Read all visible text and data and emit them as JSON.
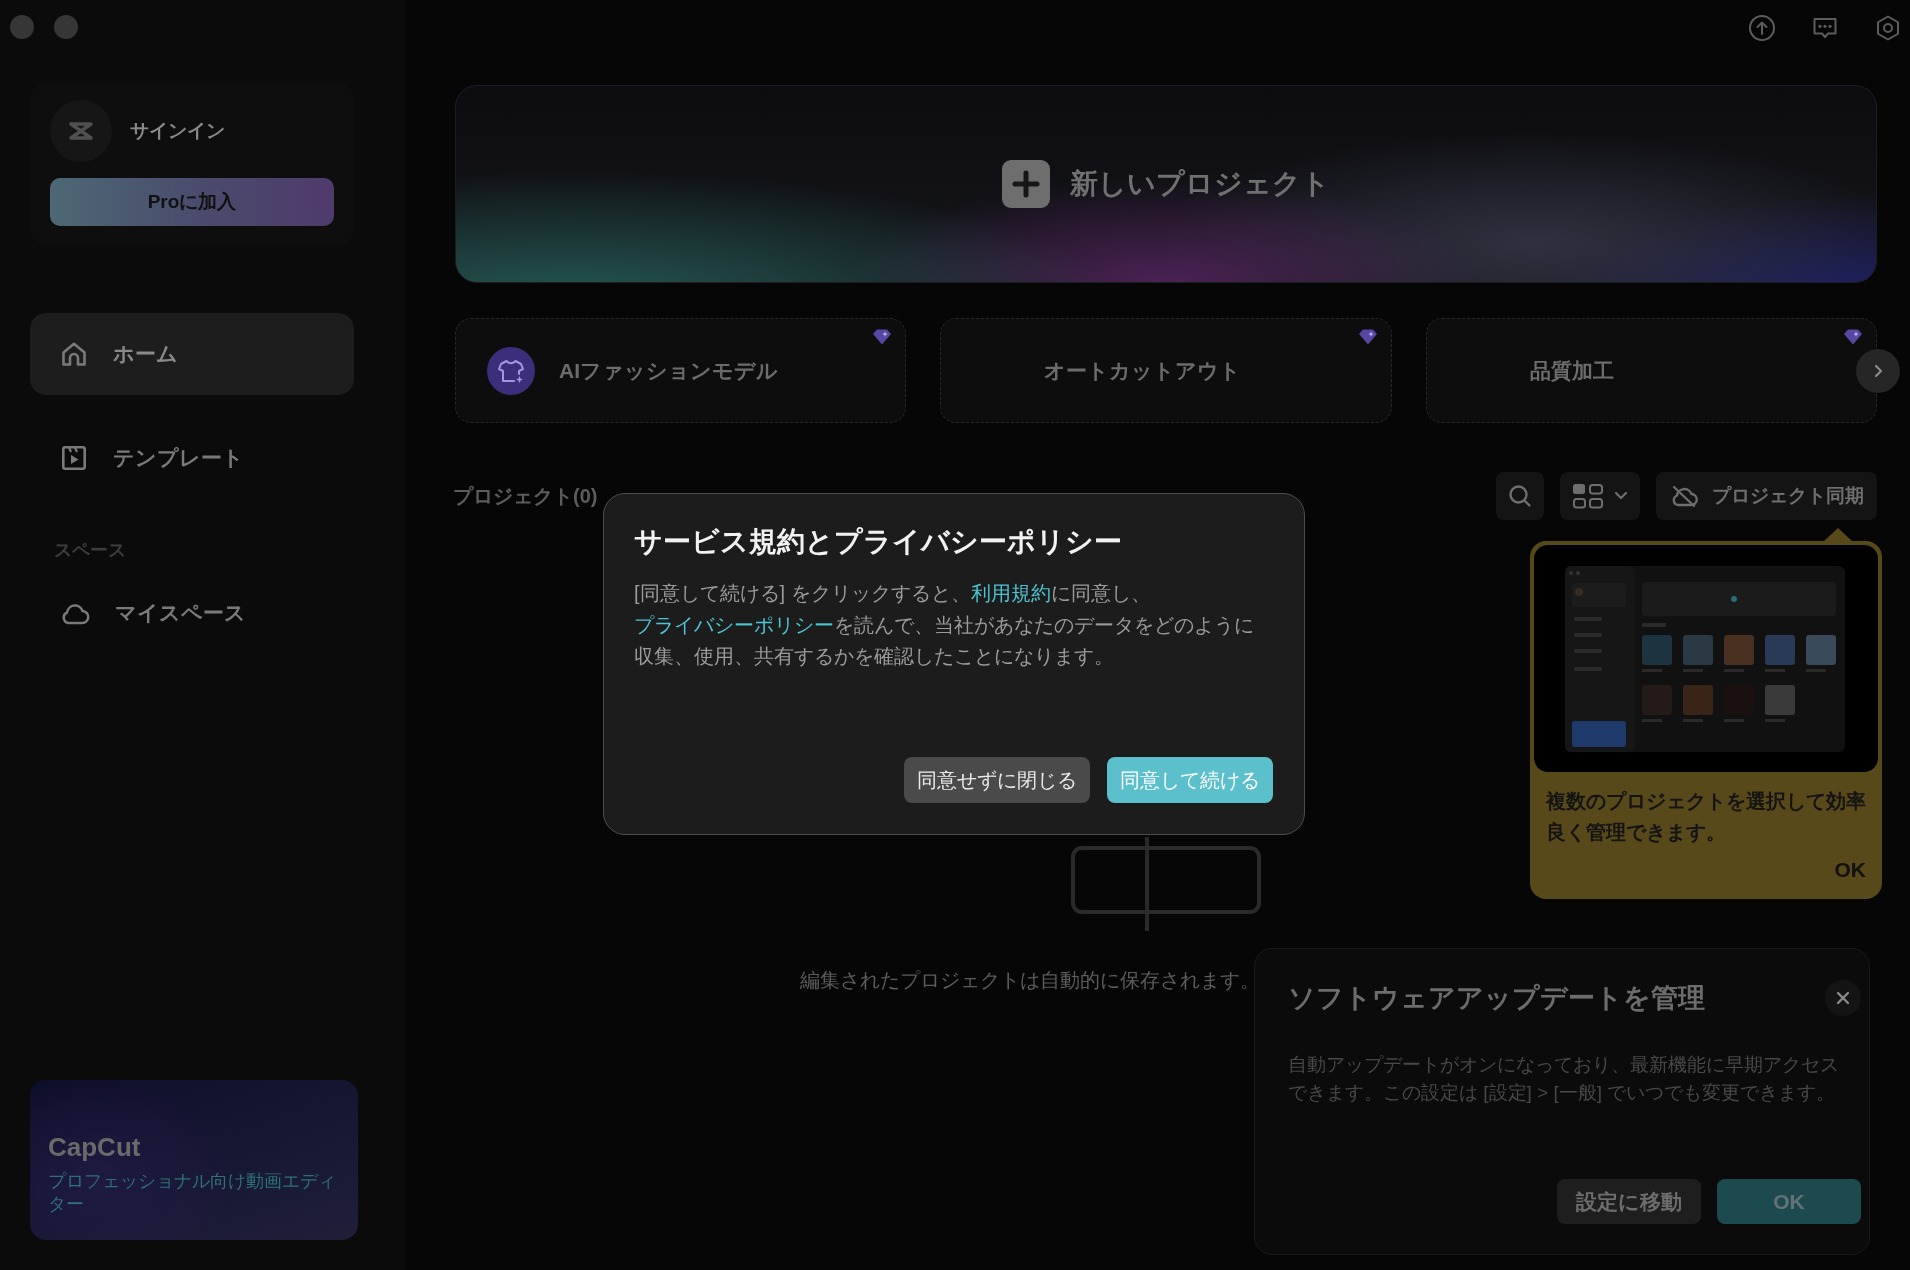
{
  "sidebar": {
    "account": {
      "label": "サインイン",
      "pro_button": "Proに加入"
    },
    "nav": [
      {
        "label": "ホーム",
        "selected": true
      },
      {
        "label": "テンプレート",
        "selected": false
      }
    ],
    "space_section": {
      "title": "スペース",
      "items": [
        {
          "label": "マイスペース",
          "selected": false
        }
      ]
    },
    "promo": {
      "title": "CapCut",
      "subtitle": "プロフェッショナル向け動画エディター"
    }
  },
  "banner": {
    "label": "新しいプロジェクト"
  },
  "features": [
    {
      "label": "AIファッションモデル",
      "premium": true
    },
    {
      "label": "オートカットアウト",
      "premium": true
    },
    {
      "label": "品質加工",
      "premium": true
    }
  ],
  "projects": {
    "title": "プロジェクト(0)",
    "sync_button": "プロジェクト同期",
    "empty_text": "編集されたプロジェクトは自動的に保存されます。"
  },
  "dialog": {
    "title": "サービス規約とプライバシーポリシー",
    "body": [
      {
        "kind": "text",
        "text": "[同意して続ける] をクリックすると、"
      },
      {
        "kind": "link",
        "text": "利用規約"
      },
      {
        "kind": "text",
        "text": "に同意し、"
      },
      {
        "kind": "link",
        "text": "プライバシーポリシー"
      },
      {
        "kind": "text",
        "text": "を読んで、当社があなたのデータをどのように収集、使用、共有するかを確認したことになります。"
      }
    ],
    "buttons": [
      {
        "label": "同意せずに閉じる",
        "kind": "secondary"
      },
      {
        "label": "同意して続ける",
        "kind": "primary"
      }
    ]
  },
  "tooltip": {
    "text": "複数のプロジェクトを選択して効率良く管理できます。",
    "button": "OK"
  },
  "update_panel": {
    "title": "ソフトウェアアップデートを管理",
    "body": "自動アップデートがオンになっており、最新機能に早期アクセスできます。この設定は [設定] > [一般] でいつでも変更できます。",
    "buttons": [
      {
        "label": "設定に移動",
        "kind": "secondary"
      },
      {
        "label": "OK",
        "kind": "primary"
      }
    ]
  }
}
